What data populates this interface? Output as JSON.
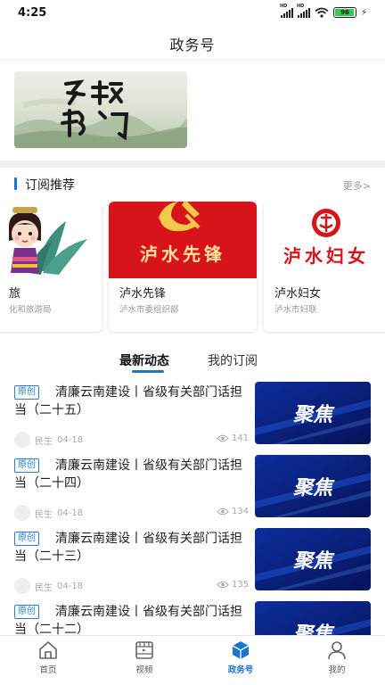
{
  "status_bar": {
    "time": "4:25",
    "battery": "96",
    "battery_level": 0.96,
    "network_label": "HD"
  },
  "header": {
    "title": "政务号"
  },
  "banner": {
    "artwork_text": "乡镇部门"
  },
  "recommend": {
    "title": "订阅推荐",
    "more_label": "更多>",
    "cards": [
      {
        "name": "旅",
        "subtitle": "化和旅游局"
      },
      {
        "name": "泸水先锋",
        "subtitle": "泸水市委组织部",
        "logo_text": "泸水先锋"
      },
      {
        "name": "泸水妇女",
        "subtitle": "泸水市妇联",
        "logo_text": "泸水妇女"
      }
    ]
  },
  "tabs": {
    "latest": "最新动态",
    "mine": "我的订阅"
  },
  "news": [
    {
      "badge": "原创",
      "title": "清廉云南建设丨省级有关部门话担当（二十五）",
      "source": "民生",
      "date": "04-18",
      "views": "141",
      "thumb_text": "聚焦"
    },
    {
      "badge": "原创",
      "title": "清廉云南建设丨省级有关部门话担当（二十四）",
      "source": "民生",
      "date": "04-18",
      "views": "134",
      "thumb_text": "聚焦"
    },
    {
      "badge": "原创",
      "title": "清廉云南建设丨省级有关部门话担当（二十三）",
      "source": "民生",
      "date": "04-18",
      "views": "135",
      "thumb_text": "聚焦"
    },
    {
      "badge": "原创",
      "title": "清廉云南建设丨省级有关部门话担当（二十二）",
      "source": "",
      "date": "",
      "views": "",
      "thumb_text": "聚焦"
    }
  ],
  "bottom_nav": [
    {
      "label": "首页",
      "icon": "home-icon"
    },
    {
      "label": "视频",
      "icon": "video-icon"
    },
    {
      "label": "政务号",
      "icon": "cube-icon",
      "active": true
    },
    {
      "label": "我的",
      "icon": "user-icon"
    }
  ],
  "colors": {
    "accent": "#1b74d4",
    "badge": "#2a7dd6",
    "party_red": "#d7141a",
    "thumb_navy": "#0a1f6e"
  }
}
